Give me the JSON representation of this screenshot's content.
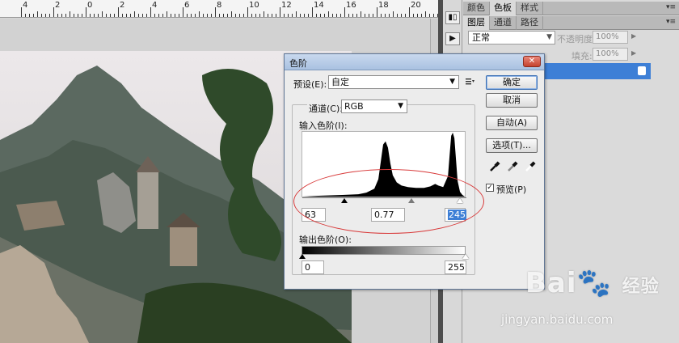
{
  "ruler": {
    "labels": [
      "4",
      "2",
      "0",
      "2",
      "4",
      "6",
      "8",
      "10",
      "12",
      "14",
      "16",
      "18",
      "20"
    ]
  },
  "panels": {
    "top_tabs": [
      "颜色",
      "色板",
      "样式"
    ],
    "layer_tabs": [
      "图层",
      "通道",
      "路径"
    ],
    "blend_mode": "正常",
    "opacity_label": "不透明度:",
    "opacity_value": "100%",
    "fill_label": "填充:",
    "fill_value": "100%",
    "menu_glyph": "▾≡"
  },
  "dialog": {
    "title": "色阶",
    "close_label": "✕",
    "preset_label": "预设(E):",
    "preset_value": "自定",
    "channel_label": "通道(C):",
    "channel_value": "RGB",
    "input_levels_label": "输入色阶(I):",
    "input_black": "63",
    "input_gamma": "0.77",
    "input_white": "245",
    "output_levels_label": "输出色阶(O):",
    "output_black": "0",
    "output_white": "255",
    "buttons": {
      "ok": "确定",
      "cancel": "取消",
      "auto": "自动(A)",
      "options": "选项(T)..."
    },
    "preview_label": "预览(P)",
    "preview_checked": true
  },
  "watermark": {
    "logo": "Bai",
    "logo_tail": "经验",
    "url": "jingyan.baidu.com"
  },
  "colors": {
    "selection_blue": "#3d7fd6",
    "annotation_red": "#d83a3a"
  }
}
